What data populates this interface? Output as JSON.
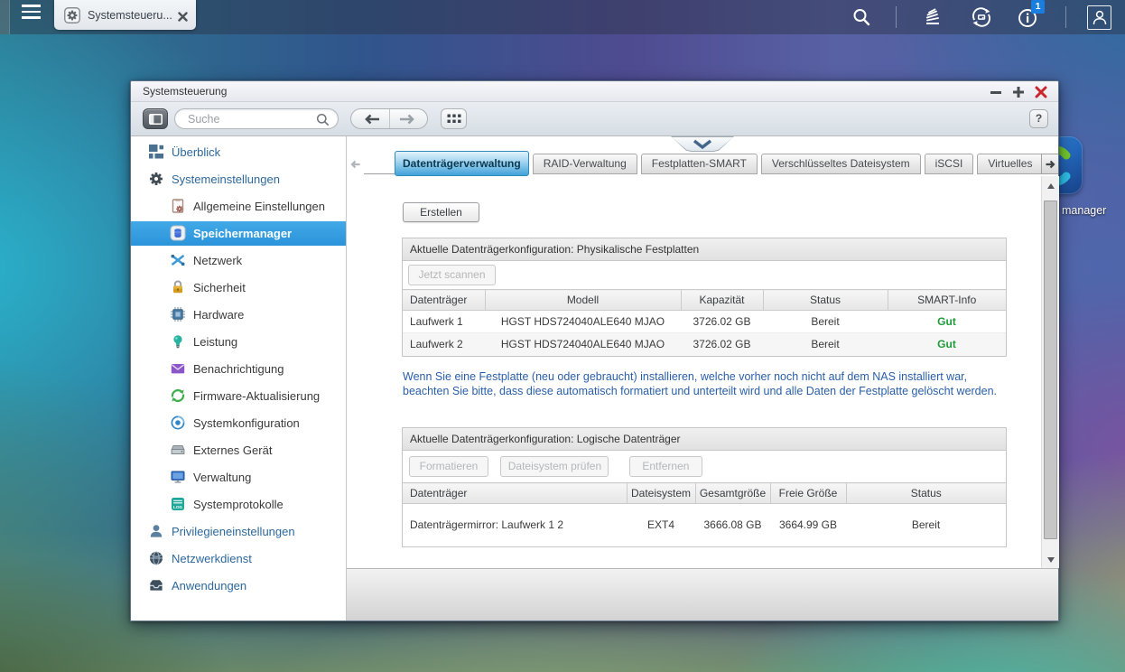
{
  "topbar": {
    "task_tab_label": "Systemsteueru...",
    "notification_count": "1",
    "icons": [
      "menu-icon",
      "gear-icon",
      "close-icon",
      "search-icon",
      "activity-monitor-icon",
      "backup-sync-icon",
      "info-icon",
      "user-icon"
    ]
  },
  "desktop": {
    "icon_label": "manager",
    "icon_name": "app-swirl-icon"
  },
  "window": {
    "title": "Systemsteuerung",
    "toolbar": {
      "search_placeholder": "Suche",
      "help_label": "?"
    },
    "sidebar": {
      "items": [
        {
          "label": "Überblick",
          "level": 1,
          "icon": "overview-icon"
        },
        {
          "label": "Systemeinstellungen",
          "level": 1,
          "icon": "system-settings-icon"
        },
        {
          "label": "Allgemeine Einstellungen",
          "level": 2,
          "icon": "general-settings-icon"
        },
        {
          "label": "Speichermanager",
          "level": 2,
          "icon": "storage-manager-icon",
          "selected": true
        },
        {
          "label": "Netzwerk",
          "level": 2,
          "icon": "network-icon"
        },
        {
          "label": "Sicherheit",
          "level": 2,
          "icon": "security-lock-icon"
        },
        {
          "label": "Hardware",
          "level": 2,
          "icon": "hardware-chip-icon"
        },
        {
          "label": "Leistung",
          "level": 2,
          "icon": "performance-bulb-icon"
        },
        {
          "label": "Benachrichtigung",
          "level": 2,
          "icon": "notification-mail-icon"
        },
        {
          "label": "Firmware-Aktualisierung",
          "level": 2,
          "icon": "firmware-update-icon"
        },
        {
          "label": "Systemkonfiguration",
          "level": 2,
          "icon": "system-config-icon"
        },
        {
          "label": "Externes Gerät",
          "level": 2,
          "icon": "external-device-icon"
        },
        {
          "label": "Verwaltung",
          "level": 2,
          "icon": "administration-monitor-icon"
        },
        {
          "label": "Systemprotokolle",
          "level": 2,
          "icon": "system-logs-icon"
        },
        {
          "label": "Privilegieneinstellungen",
          "level": 1,
          "icon": "privileges-user-icon"
        },
        {
          "label": "Netzwerkdienst",
          "level": 1,
          "icon": "network-service-globe-icon"
        },
        {
          "label": "Anwendungen",
          "level": 1,
          "icon": "applications-box-icon"
        }
      ]
    },
    "tabs": [
      {
        "label": "Datenträgerverwaltung",
        "active": true
      },
      {
        "label": "RAID-Verwaltung"
      },
      {
        "label": "Festplatten-SMART"
      },
      {
        "label": "Verschlüsseltes Dateisystem"
      },
      {
        "label": "iSCSI"
      },
      {
        "label": "Virtuelles"
      }
    ],
    "page": {
      "create_button": "Erstellen",
      "physical": {
        "title": "Aktuelle Datenträgerkonfiguration: Physikalische Festplatten",
        "scan_button": "Jetzt scannen",
        "columns": [
          "Datenträger",
          "Modell",
          "Kapazität",
          "Status",
          "SMART-Info"
        ],
        "rows": [
          [
            "Laufwerk 1",
            "HGST HDS724040ALE640 MJAO",
            "3726.02 GB",
            "Bereit",
            "Gut"
          ],
          [
            "Laufwerk 2",
            "HGST HDS724040ALE640 MJAO",
            "3726.02 GB",
            "Bereit",
            "Gut"
          ]
        ]
      },
      "note_line1": "Wenn Sie eine Festplatte (neu oder gebraucht) installieren, welche vorher noch nicht auf dem NAS installiert war,",
      "note_line2": "beachten Sie bitte, dass diese automatisch formatiert und unterteilt wird und alle Daten der Festplatte gelöscht werden.",
      "logical": {
        "title": "Aktuelle Datenträgerkonfiguration: Logische Datenträger",
        "format_button": "Formatieren",
        "check_button": "Dateisystem prüfen",
        "remove_button": "Entfernen",
        "columns": [
          "Datenträger",
          "Dateisystem",
          "Gesamtgröße",
          "Freie Größe",
          "Status"
        ],
        "rows": [
          [
            "Datenträgermirror: Laufwerk 1 2",
            "EXT4",
            "3666.08 GB",
            "3664.99 GB",
            "Bereit"
          ]
        ]
      }
    }
  },
  "colors": {
    "accent_blue": "#2b94da",
    "active_tab_blue": "#47a6dc",
    "smart_good_green": "#1e9c3a",
    "note_blue": "#2a5fa8",
    "close_red": "#c9252b",
    "badge_blue": "#1a7de0"
  }
}
